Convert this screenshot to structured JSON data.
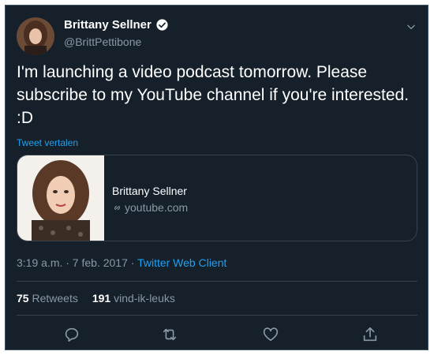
{
  "tweet": {
    "display_name": "Brittany Sellner",
    "handle": "@BrittPettibone",
    "text": "I'm launching a video podcast tomorrow. Please subscribe to my YouTube channel if you're interested. :D",
    "translate_label": "Tweet vertalen",
    "timestamp": "3:19 a.m. · 7 feb. 2017 · ",
    "client": "Twitter Web Client"
  },
  "card": {
    "title": "Brittany Sellner",
    "domain": "youtube.com"
  },
  "stats": {
    "retweets_count": "75",
    "retweets_label": "Retweets",
    "likes_count": "191",
    "likes_label": "vind-ik-leuks"
  },
  "icons": {
    "verified": "verified-badge-icon",
    "menu": "chevron-down-icon",
    "link": "link-icon",
    "reply": "reply-icon",
    "retweet": "retweet-icon",
    "like": "heart-icon",
    "share": "share-icon"
  },
  "colors": {
    "background": "#15202b",
    "accent": "#1da1f2",
    "secondary_text": "#8899a6",
    "border": "#38444d"
  }
}
